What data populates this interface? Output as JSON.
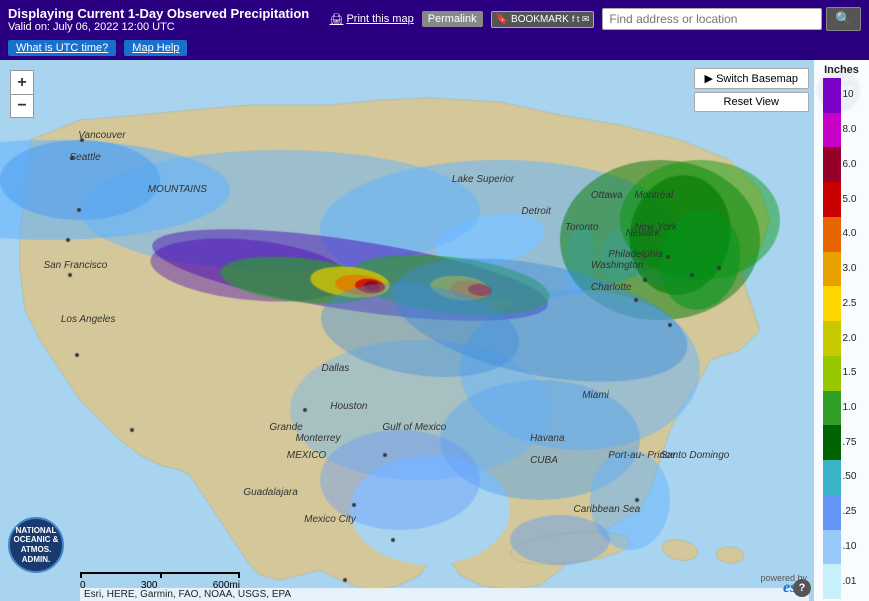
{
  "header": {
    "title": "Displaying Current 1-Day Observed Precipitation",
    "valid": "Valid on: July 06, 2022 12:00 UTC",
    "print_label": "Print this map",
    "permalink_label": "Permalink",
    "bookmark_label": "BOOKMARK",
    "search_placeholder": "Find address or location"
  },
  "sub_header": {
    "utc_btn": "What is UTC time?",
    "help_btn": "Map Help"
  },
  "map_controls": {
    "switch_basemap": "Switch Basemap",
    "reset_view": "Reset View"
  },
  "zoom": {
    "plus": "+",
    "minus": "−"
  },
  "legend": {
    "title": "Inches",
    "items": [
      {
        "label": "10",
        "color": "#7b00c8"
      },
      {
        "label": "8.0",
        "color": "#c800c8"
      },
      {
        "label": "6.0",
        "color": "#960028"
      },
      {
        "label": "5.0",
        "color": "#c80000"
      },
      {
        "label": "4.0",
        "color": "#e86400"
      },
      {
        "label": "3.0",
        "color": "#e8a000"
      },
      {
        "label": "2.5",
        "color": "#ffd700"
      },
      {
        "label": "2.0",
        "color": "#c8c800"
      },
      {
        "label": "1.5",
        "color": "#96c800"
      },
      {
        "label": "1.0",
        "color": "#32a028"
      },
      {
        "label": ".75",
        "color": "#006400"
      },
      {
        "label": ".50",
        "color": "#3cb4c8"
      },
      {
        "label": ".25",
        "color": "#6496fa"
      },
      {
        "label": ".10",
        "color": "#96c8fa"
      },
      {
        "label": ".01",
        "color": "#c8f0fa"
      }
    ]
  },
  "scale": {
    "labels": [
      "0",
      "300",
      "600mi"
    ]
  },
  "attribution": "Esri, HERE, Garmin, FAO, NOAA, USGS, EPA",
  "map_labels": [
    {
      "id": "vancouver",
      "text": "Vancouver",
      "top": "13%",
      "left": "9%"
    },
    {
      "id": "seattle",
      "text": "Seattle",
      "top": "17%",
      "left": "8%"
    },
    {
      "id": "san_francisco",
      "text": "San Francisco",
      "top": "37%",
      "left": "5%"
    },
    {
      "id": "los_angeles",
      "text": "Los Angeles",
      "top": "47%",
      "left": "7%"
    },
    {
      "id": "dallas",
      "text": "Dallas",
      "top": "56%",
      "left": "37%"
    },
    {
      "id": "houston",
      "text": "Houston",
      "top": "63%",
      "left": "38%"
    },
    {
      "id": "monterrey",
      "text": "Monterrey",
      "top": "69%",
      "left": "34%"
    },
    {
      "id": "guadalajara",
      "text": "Guadalajara",
      "top": "79%",
      "left": "28%"
    },
    {
      "id": "mexico_city",
      "text": "Mexico City",
      "top": "84%",
      "left": "35%"
    },
    {
      "id": "detroit",
      "text": "Detroit",
      "top": "27%",
      "left": "60%"
    },
    {
      "id": "philadelphia",
      "text": "Philadelphia",
      "top": "35%",
      "left": "70%"
    },
    {
      "id": "new_york",
      "text": "New York",
      "top": "30%",
      "left": "73%"
    },
    {
      "id": "ottawa",
      "text": "Ottawa",
      "top": "24%",
      "left": "68%"
    },
    {
      "id": "montreal",
      "text": "Montréal",
      "top": "24%",
      "left": "73%"
    },
    {
      "id": "toronto",
      "text": "Toronto",
      "top": "30%",
      "left": "65%"
    },
    {
      "id": "washington",
      "text": "Washington",
      "top": "37%",
      "left": "68%"
    },
    {
      "id": "charlotte",
      "text": "Charlotte",
      "top": "41%",
      "left": "68%"
    },
    {
      "id": "miami",
      "text": "Miami",
      "top": "61%",
      "left": "67%"
    },
    {
      "id": "havana",
      "text": "Havana",
      "top": "69%",
      "left": "61%"
    },
    {
      "id": "cuba",
      "text": "CUBA",
      "top": "73%",
      "left": "61%"
    },
    {
      "id": "grand_rio",
      "text": "Grande",
      "top": "67%",
      "left": "31%"
    },
    {
      "id": "gulf_of_mexico",
      "text": "Gulf of\nMexico",
      "top": "67%",
      "left": "44%"
    },
    {
      "id": "mexico_label",
      "text": "MEXICO",
      "top": "72%",
      "left": "33%"
    },
    {
      "id": "mountains",
      "text": "MOUNTAINS",
      "top": "23%",
      "left": "17%"
    },
    {
      "id": "lake_superior",
      "text": "Lake\nSuperior",
      "top": "21%",
      "left": "52%"
    },
    {
      "id": "haiti",
      "text": "Port-au-\nPrince",
      "top": "72%",
      "left": "70%"
    },
    {
      "id": "santo_domingo",
      "text": "Santo\nDomingo",
      "top": "72%",
      "left": "76%"
    },
    {
      "id": "caribbean",
      "text": "Caribbean Sea",
      "top": "82%",
      "left": "66%"
    },
    {
      "id": "newark",
      "text": "Newark",
      "top": "31%",
      "left": "72%"
    }
  ],
  "noaa": {
    "label": "NOAA"
  },
  "esri": {
    "label": "esri"
  },
  "help": {
    "label": "?"
  }
}
